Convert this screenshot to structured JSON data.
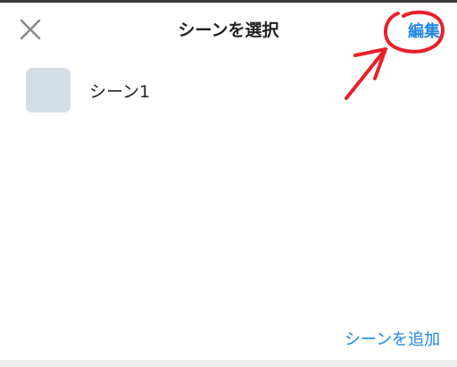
{
  "header": {
    "title": "シーンを選択",
    "edit_label": "編集"
  },
  "scenes": [
    {
      "label": "シーン1"
    }
  ],
  "footer": {
    "add_scene_label": "シーンを追加"
  },
  "colors": {
    "accent": "#1e88e5",
    "text": "#222222",
    "icon": "#8a8a8a",
    "thumbnail": "#d5dee6",
    "annotation": "#e8202a"
  },
  "icons": {
    "close": "close-icon"
  }
}
